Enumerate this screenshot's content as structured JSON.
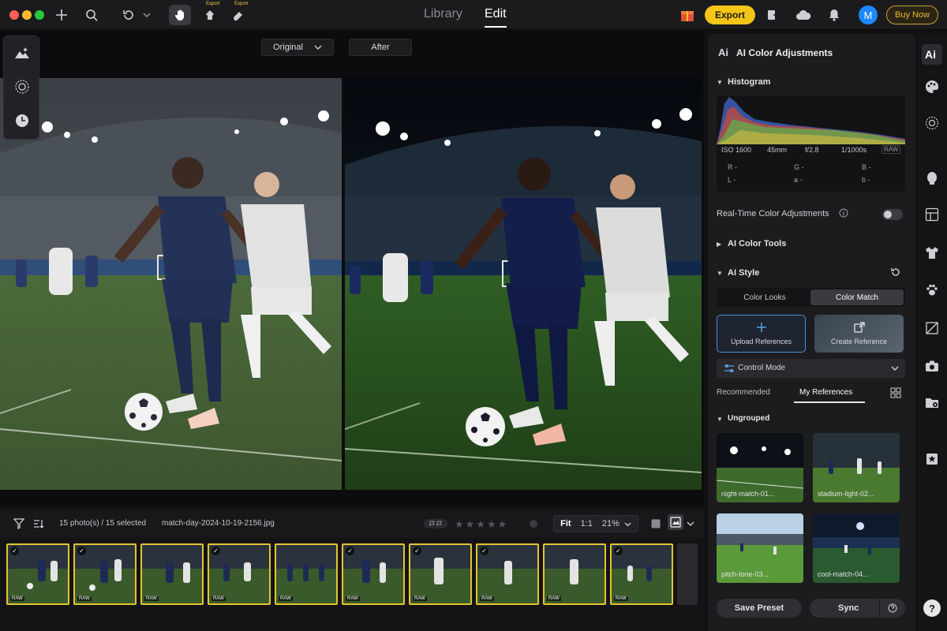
{
  "header": {
    "tabs": [
      {
        "label": "Library"
      },
      {
        "label": "Edit"
      }
    ],
    "export_label": "Export",
    "avatar_initial": "M",
    "buy_label": "Buy Now",
    "tool_tag": "Export"
  },
  "canvas": {
    "original_label": "Original",
    "after_label": "After"
  },
  "filmstrip": {
    "count_label": "15 photo(s) / 15 selected",
    "filename": "match-day-2024-10-19-2156.jpg",
    "fit_label": "Fit",
    "one_to_one": "1:1",
    "zoom_value": "21%",
    "raw_badge": "RAW",
    "check": "✓",
    "stars": "★★★★★"
  },
  "panel": {
    "title": "AI Color Adjustments",
    "histogram": {
      "title": "Histogram",
      "iso": "ISO 1600",
      "focal": "45mm",
      "aperture": "f/2.8",
      "shutter": "1/1000s",
      "raw": "RAW",
      "r": "R -",
      "g": "G -",
      "b": "B -",
      "l": "L -",
      "a": "a -",
      "b2": "b -"
    },
    "realtime_label": "Real-Time Color Adjustments",
    "color_tools": "AI Color Tools",
    "ai_style": "AI Style",
    "segments": [
      "Color Looks",
      "Color Match"
    ],
    "upload_label": "Upload References",
    "create_label": "Create Reference",
    "control_mode": "Control Mode",
    "ref_tabs": [
      "Recommended",
      "My References"
    ],
    "ungrouped": "Ungrouped",
    "references": [
      {
        "name": "night-match-01..."
      },
      {
        "name": "stadium-light-02..."
      },
      {
        "name": "pitch-tone-03..."
      },
      {
        "name": "cool-match-04..."
      }
    ],
    "save_preset": "Save Preset",
    "sync": "Sync"
  },
  "colors": {
    "accent": "#f5c518",
    "avatar": "#1e88ff",
    "selection": "#e3c431"
  }
}
